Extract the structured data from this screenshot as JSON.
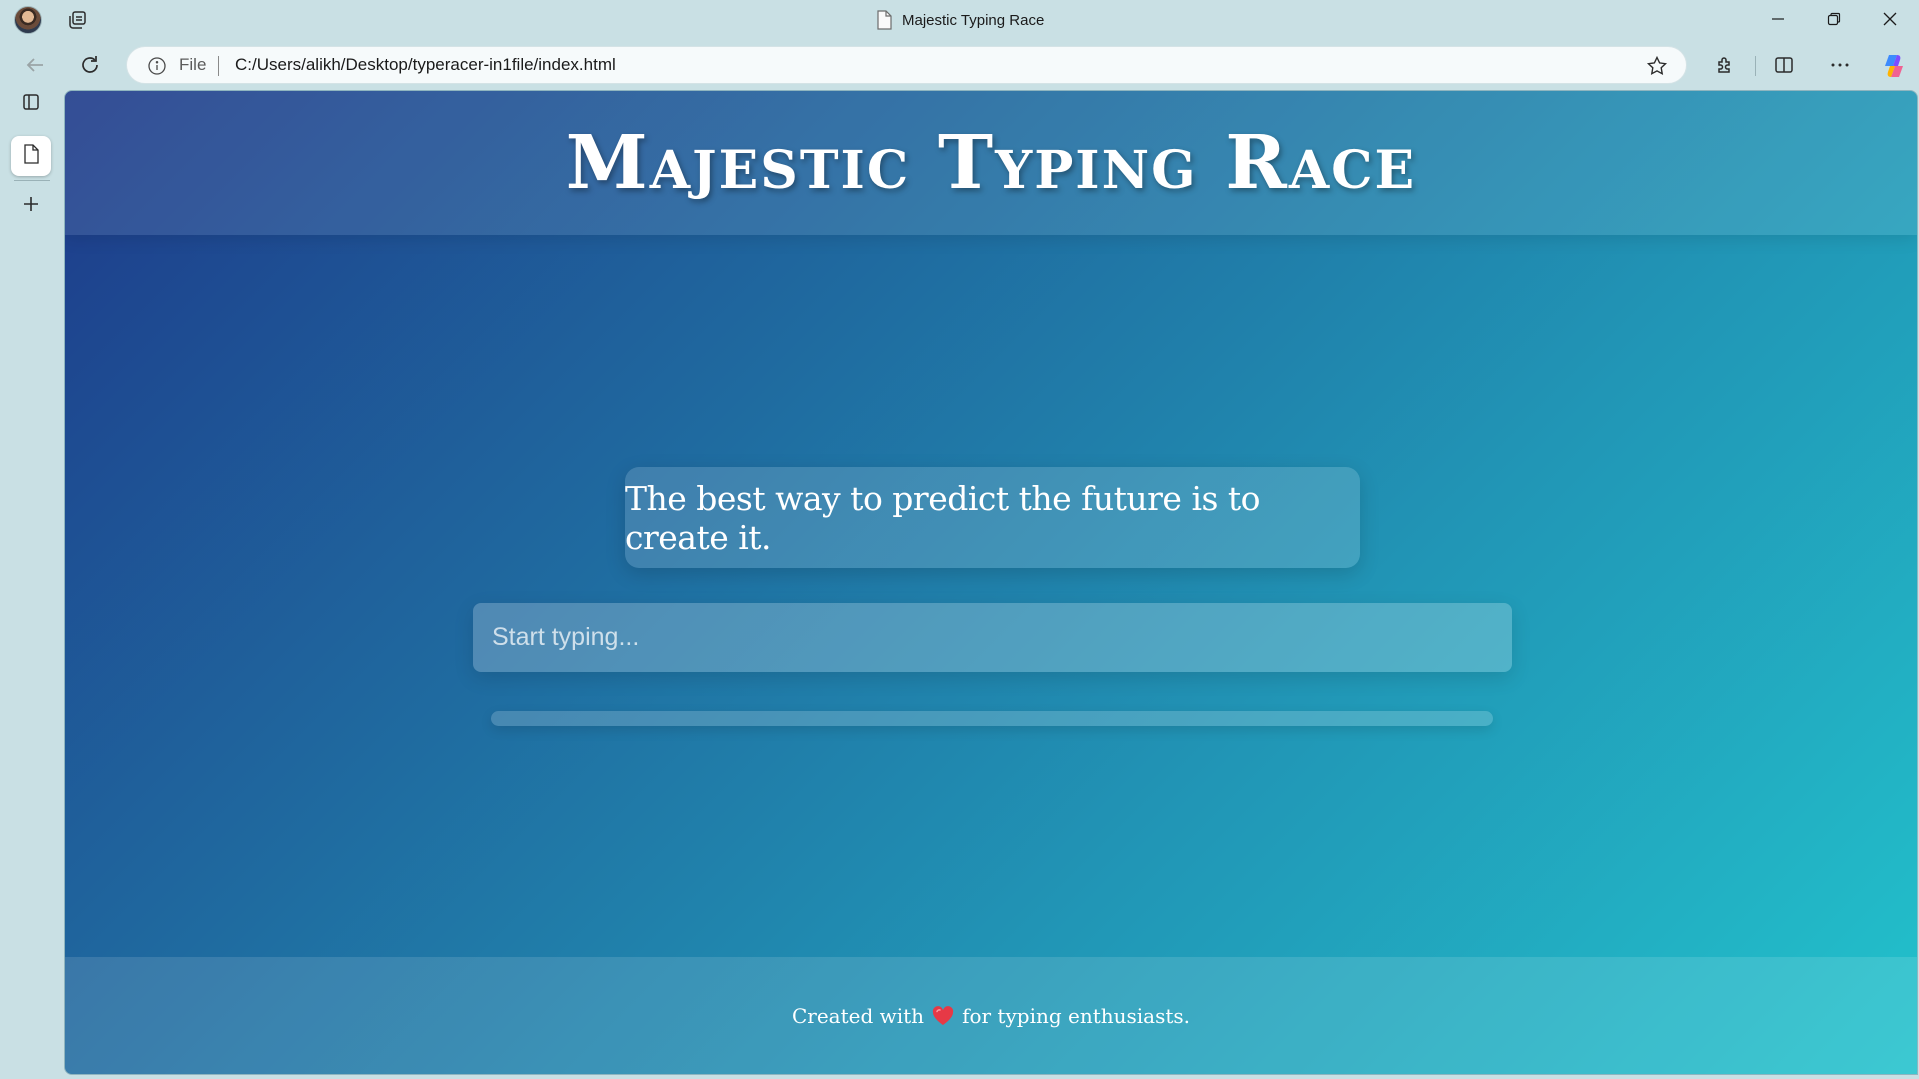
{
  "browser": {
    "tab_title": "Majestic Typing Race",
    "address": {
      "scheme_label": "File",
      "url": "C:/Users/alikh/Desktop/typeracer-in1file/index.html"
    },
    "icons": {
      "profile": "avatar",
      "collections": "collections-icon",
      "page": "page-icon",
      "back": "back-arrow-icon",
      "refresh": "refresh-icon",
      "info": "info-icon",
      "favorite": "star-icon",
      "extensions": "puzzle-icon",
      "split_screen": "split-screen-icon",
      "more": "more-icon",
      "copilot": "copilot-icon",
      "minimize": "minimize-icon",
      "restore": "restore-icon",
      "close": "close-icon",
      "tab_actions": "tab-actions-icon",
      "new_tab": "plus-icon"
    }
  },
  "page": {
    "header": {
      "title": "Majestic Typing Race"
    },
    "quote": {
      "text": "The best way to predict the future is to create it."
    },
    "input": {
      "placeholder": "Start typing...",
      "value": ""
    },
    "progress": {
      "percent": 0
    },
    "footer": {
      "text_before": "Created with",
      "heart": "heart-icon",
      "text_after": "for typing enthusiasts."
    }
  },
  "colors": {
    "gradient_start": "#1e3a8a",
    "gradient_end": "#22c2cc",
    "heart": "#e63946"
  }
}
